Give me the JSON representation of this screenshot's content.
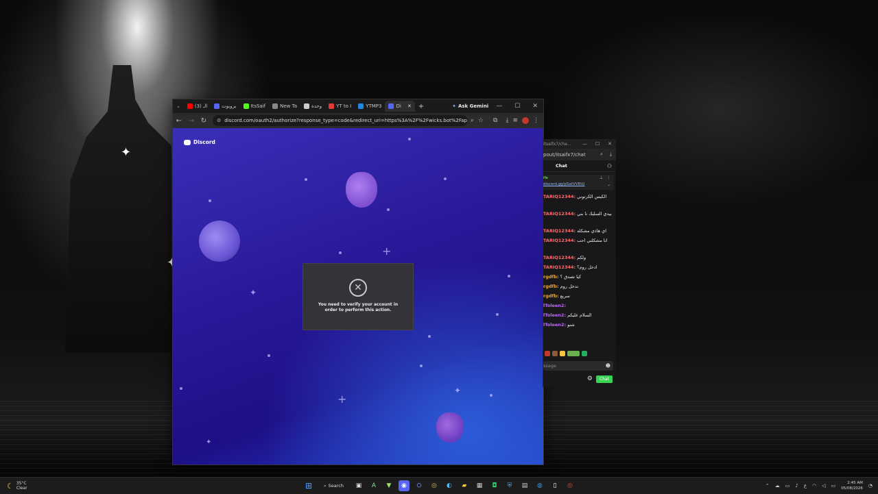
{
  "taskbar": {
    "weather": {
      "temp": "35°C",
      "cond": "Clear"
    },
    "search_label": "Search",
    "clock": {
      "time": "2:45 AM",
      "date": "05/08/2026"
    },
    "tray_lang": "ع"
  },
  "browser": {
    "tabs": [
      {
        "label": "(3) الـ",
        "color": "#ff0000"
      },
      {
        "label": "بروبوت",
        "color": "#5865f2"
      },
      {
        "label": "ItsSaif",
        "color": "#53fc18"
      },
      {
        "label": "New Ta",
        "color": "#888888"
      },
      {
        "label": "وحدة",
        "color": "#cccccc"
      },
      {
        "label": "YT to I",
        "color": "#e53935"
      },
      {
        "label": "YTMP3",
        "color": "#1e88e5"
      },
      {
        "label": "Di",
        "color": "#5865f2"
      }
    ],
    "new_tab": "+",
    "gemini_label": "Ask Gemini",
    "url": "discord.com/oauth2/authorize?response_type=code&redirect_uri=https%3A%2F%2Fwicks.bot%2Fap...",
    "brand": "Discord",
    "modal_text": "You need to verify your account in order to perform this action."
  },
  "chat": {
    "window_title": "itsaifx7/cha...",
    "url": "pout/itsaifx7/chat",
    "header": "Chat",
    "pinned": {
      "line1": "ife",
      "line2": "discord.gg/pSatVVRtU"
    },
    "messages": [
      {
        "user": "TARIQ12344:",
        "text": "الكيس الكرتوني",
        "color": "#ff6b6b"
      },
      {
        "user": "TARIQ12344:",
        "text": "بيدي السليك نا بني",
        "color": "#ff6b6b"
      },
      {
        "user": "TARIQ12344:",
        "text": "اي هاذي مشكله",
        "color": "#ff6b6b"
      },
      {
        "user": "TARIQ12344:",
        "text": "انا مشكلتي احب",
        "color": "#ff6b6b"
      },
      {
        "user": "TARIQ12344:",
        "text": "ولكم",
        "color": "#ff6b6b"
      },
      {
        "user": "TARIQ12344:",
        "text": "ادخل روم؟",
        "color": "#ff6b6b"
      },
      {
        "user": "rgdfb:",
        "text": "كيا تصدق ؟",
        "color": "#e8a33d"
      },
      {
        "user": "rgdfb:",
        "text": "تدخل روم",
        "color": "#e8a33d"
      },
      {
        "user": "rgdfb:",
        "text": "سريع",
        "color": "#e8a33d"
      },
      {
        "user": "lToleen2:",
        "text": "",
        "color": "#c06bff"
      },
      {
        "user": "lToleen2:",
        "text": "السلام عليكم",
        "color": "#c06bff"
      },
      {
        "user": "lToleen2:",
        "text": "شنو",
        "color": "#c06bff"
      }
    ],
    "input_placeholder": "ssage",
    "send_label": "Chat"
  },
  "icons": {
    "discord_logo": "discord-logo-icon",
    "close_circle": "close-circle-icon"
  }
}
